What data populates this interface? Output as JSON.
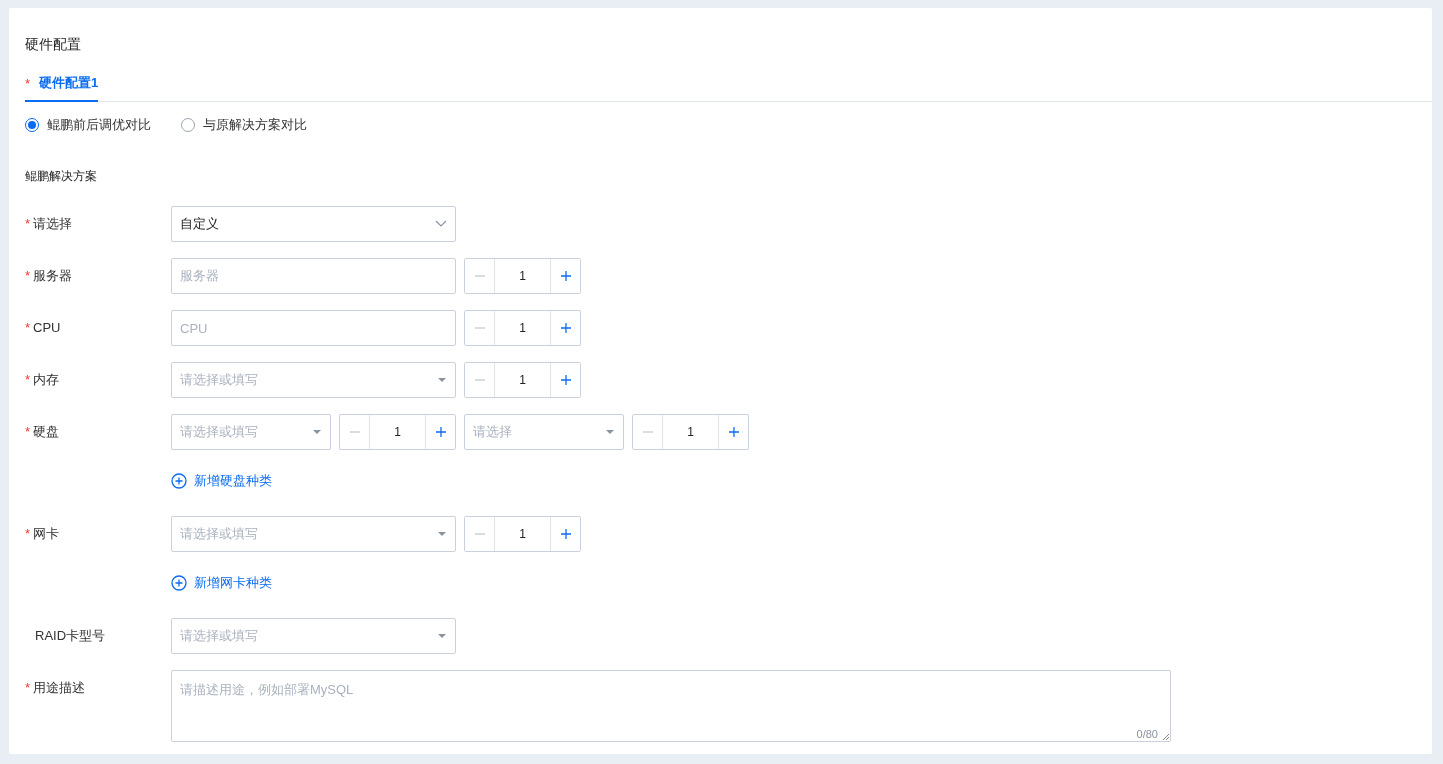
{
  "title": "硬件配置",
  "tabs": [
    {
      "label": "硬件配置1",
      "mark": "*",
      "selected": true
    }
  ],
  "radios": [
    {
      "label": "鲲鹏前后调优对比",
      "selected": true
    },
    {
      "label": "与原解决方案对比",
      "selected": false
    }
  ],
  "section_title": "鲲鹏解决方案",
  "rows": [
    {
      "kind": "field",
      "label": "请选择",
      "mark": "*",
      "controls": [
        {
          "kind": "select",
          "value": "自定义"
        }
      ]
    },
    {
      "kind": "field",
      "label": "服务器",
      "mark": "*",
      "controls": [
        {
          "kind": "input",
          "placeholder": "服务器"
        },
        {
          "kind": "stepper",
          "value": "1",
          "minus_disabled": true
        }
      ]
    },
    {
      "kind": "field",
      "label": "CPU",
      "mark": "*",
      "controls": [
        {
          "kind": "input",
          "placeholder": "CPU"
        },
        {
          "kind": "stepper",
          "value": "1",
          "minus_disabled": true
        }
      ]
    },
    {
      "kind": "field",
      "label": "内存",
      "mark": "*",
      "controls": [
        {
          "kind": "combo",
          "placeholder": "请选择或填写"
        },
        {
          "kind": "stepper",
          "value": "1",
          "minus_disabled": true
        }
      ]
    },
    {
      "kind": "field",
      "label": "硬盘",
      "mark": "*",
      "controls": [
        {
          "kind": "combo",
          "placeholder": "请选择或填写"
        },
        {
          "kind": "stepper",
          "value": "1",
          "minus_disabled": true
        },
        {
          "kind": "combo",
          "placeholder": "请选择"
        },
        {
          "kind": "stepper",
          "value": "1",
          "minus_disabled": true
        }
      ]
    },
    {
      "kind": "add",
      "label": "新增硬盘种类"
    },
    {
      "kind": "field",
      "label": "网卡",
      "mark": "*",
      "controls": [
        {
          "kind": "combo",
          "placeholder": "请选择或填写"
        },
        {
          "kind": "stepper",
          "value": "1",
          "minus_disabled": true
        }
      ]
    },
    {
      "kind": "add",
      "label": "新增网卡种类"
    },
    {
      "kind": "field",
      "label": "RAID卡型号",
      "controls": [
        {
          "kind": "combo",
          "placeholder": "请选择或填写"
        }
      ]
    },
    {
      "kind": "field",
      "label": "用途描述",
      "mark": "*",
      "controls": [
        {
          "kind": "textarea",
          "placeholder": "请描述用途，例如部署MySQL",
          "counter": "0/80"
        }
      ]
    }
  ]
}
